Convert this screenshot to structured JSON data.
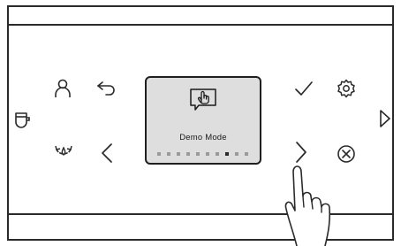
{
  "display": {
    "mode_label": "Demo Mode",
    "icon": "touch-hand-icon",
    "page_indicator": {
      "total": 10,
      "active": 8
    }
  },
  "icons": {
    "cup": "cup-icon",
    "profile": "user-profile-icon",
    "back": "back-arrow-icon",
    "rinse": "rinse-icon",
    "previous": "chevron-left-icon",
    "confirm": "checkmark-icon",
    "settings": "gear-icon",
    "next": "chevron-right-icon",
    "cancel": "cancel-icon",
    "expand": "triangle-right-icon",
    "finger": "pointing-hand-icon"
  },
  "colors": {
    "line": "#2a2a2a",
    "display_bg": "#dedede"
  }
}
